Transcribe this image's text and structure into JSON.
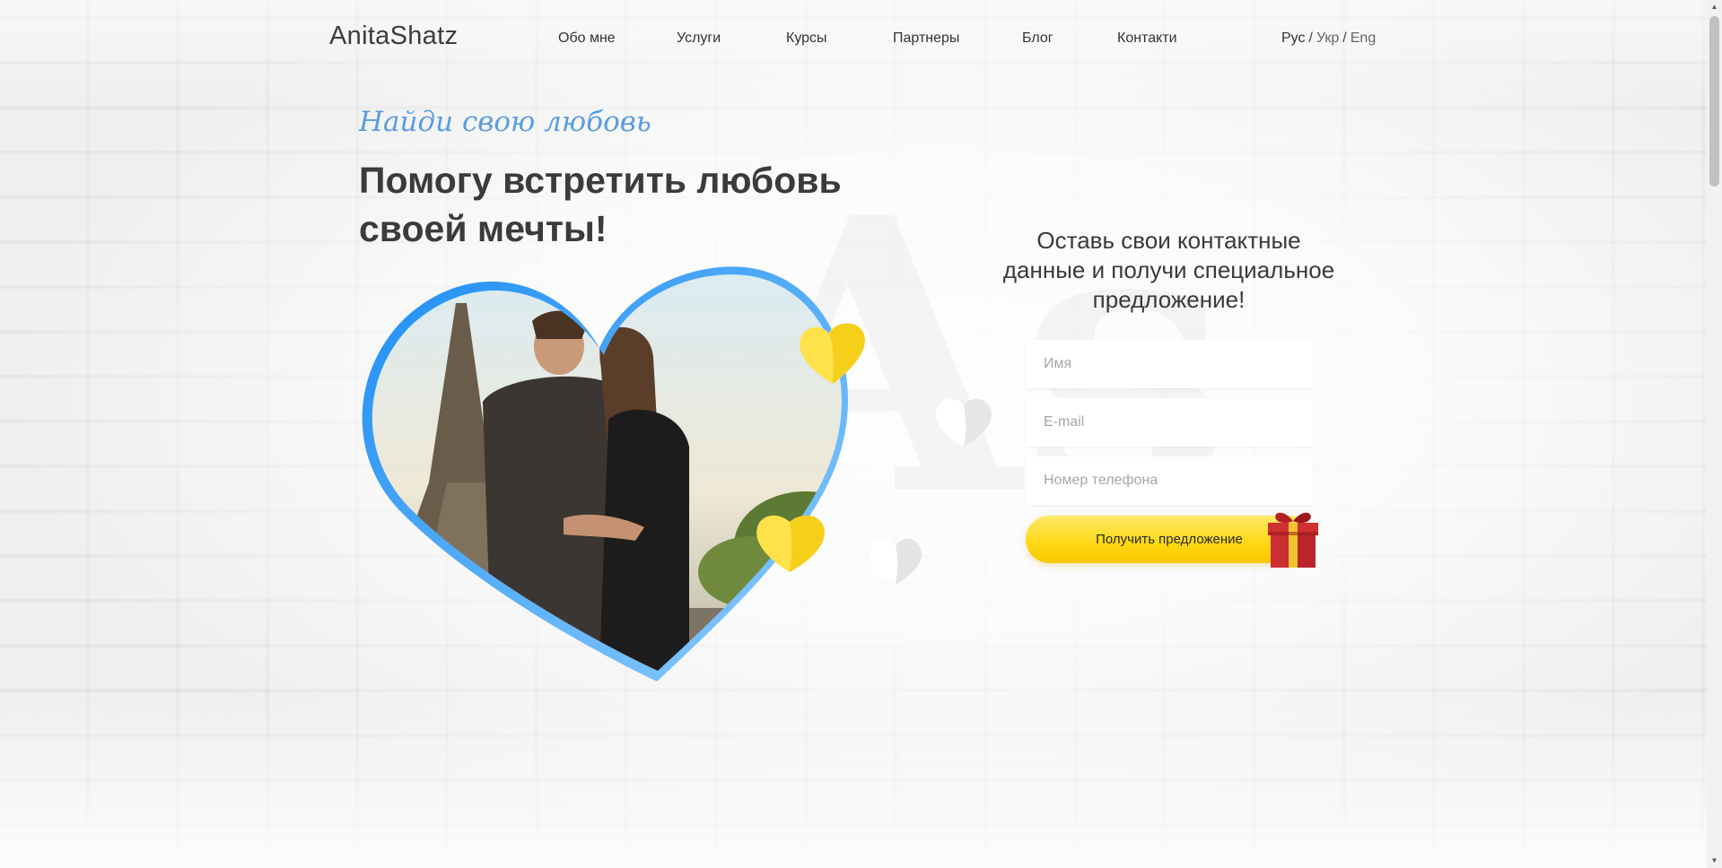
{
  "header": {
    "logo": "AnitaShatz",
    "nav": [
      {
        "label": "Обо мне"
      },
      {
        "label": "Услуги"
      },
      {
        "label": "Курсы"
      },
      {
        "label": "Партнеры"
      },
      {
        "label": "Блог"
      },
      {
        "label": "Контакти"
      }
    ],
    "languages": {
      "ru": "Рус",
      "uk": "Укр",
      "en": "Eng",
      "separator": "/"
    }
  },
  "hero": {
    "script_title": "Найди свою любовь",
    "title_line1": "Помогу встретить любовь",
    "title_line2": "своей мечты!",
    "watermark": "As"
  },
  "form": {
    "heading_line1": "Оставь свои контактные",
    "heading_line2": "данные и получи специальное",
    "heading_line3": "предложение!",
    "name_placeholder": "Имя",
    "email_placeholder": "E-mail",
    "phone_placeholder": "Номер телефона",
    "submit_label": "Получить предложение"
  },
  "colors": {
    "accent_blue": "#2e9bf5",
    "accent_yellow": "#ffd712",
    "gift_red": "#c0262a"
  },
  "icons": {
    "heart_frame": "heart-frame-icon",
    "yellow_heart": "yellow-heart-icon",
    "white_heart": "white-heart-icon",
    "gift": "gift-icon"
  }
}
